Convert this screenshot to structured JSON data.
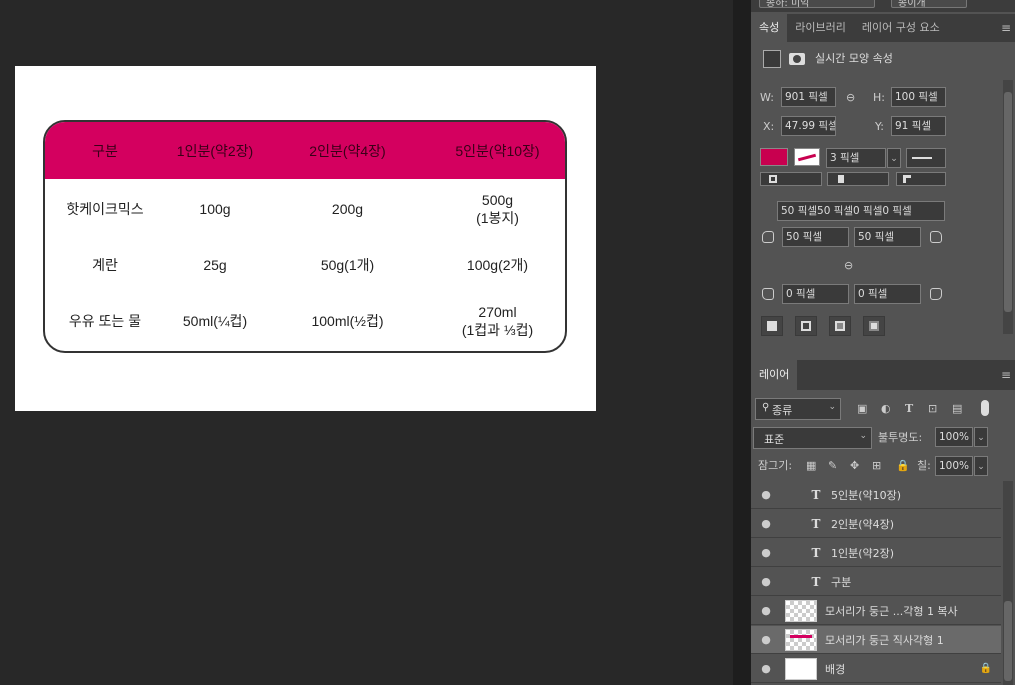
{
  "document": {
    "table": {
      "headers": [
        "구분",
        "1인분(약2장)",
        "2인분(약4장)",
        "5인분(약10장)"
      ],
      "rows": [
        [
          "핫케이크믹스",
          "100g",
          "200g",
          "500g\n(1봉지)"
        ],
        [
          "계란",
          "25g",
          "50g(1개)",
          "100g(2개)"
        ],
        [
          "우유 또는 물",
          "50ml(¼컵)",
          "100ml(½컵)",
          "270ml\n(1컵과 ⅓컵)"
        ]
      ],
      "header_color": "#d4005f"
    }
  },
  "top_strip": {
    "left_dropdown": "종하: 미익",
    "right_dropdown": "종이개"
  },
  "properties_panel": {
    "tabs": [
      "속성",
      "라이브러리",
      "레이어 구성 요소"
    ],
    "title": "실시간 모양 속성",
    "w_label": "W:",
    "w_value": "901 픽셀",
    "h_label": "H:",
    "h_value": "100 픽셀",
    "x_label": "X:",
    "x_value": "47.99 픽셀",
    "y_label": "Y:",
    "y_value": "91 픽셀",
    "fill_color": "#c8004f",
    "stroke_width": "3 픽셀",
    "radius_summary": "50 픽셀50 픽셀0 픽셀0 픽셀",
    "radius_tl": "50 픽셀",
    "radius_tr": "50 픽셀",
    "radius_bl": "0 픽셀",
    "radius_br": "0 픽셀"
  },
  "layers_panel": {
    "tab": "레이어",
    "filter_label": "종류",
    "blend_mode": "표준",
    "opacity_label": "불투명도:",
    "opacity_value": "100%",
    "lock_label": "잠그기:",
    "fill_label": "칠:",
    "fill_value": "100%",
    "layers": [
      {
        "name": "5인분(약10장)",
        "type": "text"
      },
      {
        "name": "2인분(약4장)",
        "type": "text"
      },
      {
        "name": "1인분(약2장)",
        "type": "text"
      },
      {
        "name": "구분",
        "type": "text"
      },
      {
        "name": "모서리가 둥근 ...각형 1 복사",
        "type": "shape"
      },
      {
        "name": "모서리가 둥근 직사각형 1",
        "type": "shape",
        "selected": true
      },
      {
        "name": "배경",
        "type": "background",
        "locked": true
      }
    ]
  }
}
